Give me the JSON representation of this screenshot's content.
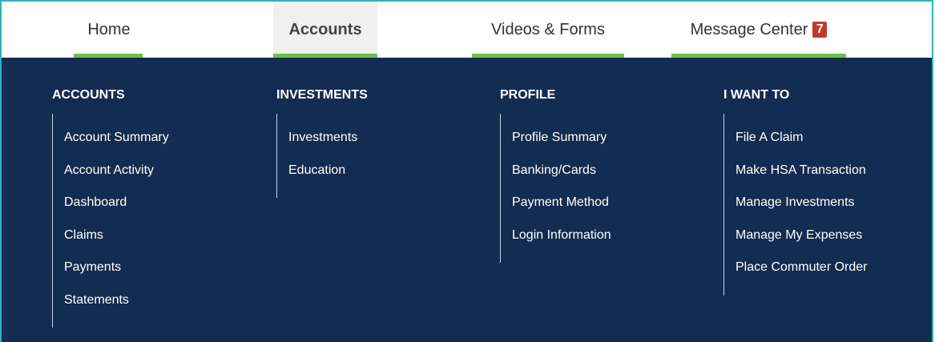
{
  "nav": {
    "tabs": [
      {
        "label": "Home"
      },
      {
        "label": "Accounts"
      },
      {
        "label": "Videos & Forms"
      },
      {
        "label": "Message Center",
        "badge": "7"
      }
    ]
  },
  "menu": {
    "columns": [
      {
        "heading": "ACCOUNTS",
        "items": [
          "Account Summary",
          "Account Activity",
          "Dashboard",
          "Claims",
          "Payments",
          "Statements"
        ]
      },
      {
        "heading": "INVESTMENTS",
        "items": [
          "Investments",
          "Education"
        ]
      },
      {
        "heading": "PROFILE",
        "items": [
          "Profile Summary",
          "Banking/Cards",
          "Payment Method",
          "Login Information"
        ]
      },
      {
        "heading": "I WANT TO",
        "items": [
          "File A Claim",
          "Make HSA Transaction",
          "Manage Investments",
          "Manage My Expenses",
          "Place Commuter Order"
        ]
      }
    ]
  },
  "colors": {
    "accent": "#6cc04a",
    "panel": "#122c52",
    "badge": "#c0392b",
    "frame": "#2bb3c0"
  }
}
